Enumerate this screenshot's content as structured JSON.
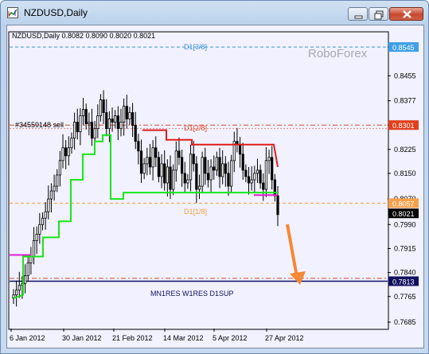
{
  "window": {
    "title": "NZDUSD,Daily",
    "controls": [
      "minimize",
      "maximize",
      "close"
    ]
  },
  "chart": {
    "header": "NZDUSD,Daily  0.8082 0.8090 0.8020 0.8021",
    "watermark": "RoboForex",
    "order_label": "#34559148 sell",
    "bottom_label": "MN1RES W1RES D1SUP",
    "level_labels": [
      {
        "text": "D1[3/8]",
        "color": "#3f95d4"
      },
      {
        "text": "D1[2/8]",
        "color": "#d94a2b"
      },
      {
        "text": "D1[1/8]",
        "color": "#f0a040"
      }
    ],
    "price_tags": [
      {
        "value": "0.8545",
        "bg": "#3fa0e6",
        "fg": "#ffffff"
      },
      {
        "value": "0.8301",
        "bg": "#e0401d",
        "fg": "#ffffff"
      },
      {
        "value": "0.8057",
        "bg": "#f6a04a",
        "fg": "#ffffff"
      },
      {
        "value": "0.8021",
        "bg": "#000000",
        "fg": "#ffffff"
      },
      {
        "value": "0.7813",
        "bg": "#10105e",
        "fg": "#ffffff"
      }
    ],
    "colors": {
      "background": "#f1f1ff",
      "candles": "#000000",
      "support_line": "#19e619",
      "resistance_line": "#e01b1b",
      "magenta_line": "#e020d0",
      "arrow": "#f58833",
      "bottom_line": "#10105e"
    }
  },
  "chart_data": {
    "type": "candlestick",
    "symbol": "NZDUSD",
    "timeframe": "Daily",
    "ohlc_last": {
      "open": 0.8082,
      "high": 0.809,
      "low": 0.802,
      "close": 0.8021
    },
    "y_ticks": [
      "0.8545",
      "0.8455",
      "0.8377",
      "0.8301",
      "0.8225",
      "0.8150",
      "0.8070",
      "0.7990",
      "0.7915",
      "0.7840",
      "0.7765",
      "0.7685"
    ],
    "x_ticks": [
      "6 Jan 2012",
      "30 Jan 2012",
      "21 Feb 2012",
      "14 Mar 2012",
      "5 Apr 2012",
      "27 Apr 2012"
    ],
    "ylim": [
      0.7665,
      0.859
    ],
    "levels": [
      {
        "name": "D1[3/8]",
        "value": 0.8545,
        "style": "dashed"
      },
      {
        "name": "D1[2/8]",
        "value": 0.8301,
        "style": "dashdot"
      },
      {
        "name": "D1[1/8]",
        "value": 0.8057,
        "style": "dashed"
      },
      {
        "name": "MN1RES W1RES D1SUP",
        "value": 0.7813,
        "style": "solid"
      }
    ],
    "closes": [
      0.777,
      0.7785,
      0.78,
      0.7805,
      0.783,
      0.787,
      0.789,
      0.794,
      0.796,
      0.799,
      0.801,
      0.803,
      0.807,
      0.8095,
      0.811,
      0.8145,
      0.819,
      0.823,
      0.8205,
      0.823,
      0.826,
      0.831,
      0.828,
      0.833,
      0.835,
      0.8305,
      0.831,
      0.826,
      0.829,
      0.833,
      0.838,
      0.834,
      0.829,
      0.832,
      0.831,
      0.833,
      0.829,
      0.831,
      0.836,
      0.832,
      0.834,
      0.83,
      0.825,
      0.822,
      0.815,
      0.818,
      0.82,
      0.817,
      0.823,
      0.82,
      0.814,
      0.818,
      0.812,
      0.817,
      0.81,
      0.816,
      0.822,
      0.82,
      0.815,
      0.812,
      0.813,
      0.821,
      0.818,
      0.81,
      0.811,
      0.82,
      0.815,
      0.813,
      0.817,
      0.816,
      0.82,
      0.814,
      0.818,
      0.815,
      0.811,
      0.819,
      0.825,
      0.824,
      0.821,
      0.816,
      0.814,
      0.812,
      0.813,
      0.815,
      0.816,
      0.812,
      0.81,
      0.819,
      0.82,
      0.813,
      0.808,
      0.8021
    ]
  }
}
